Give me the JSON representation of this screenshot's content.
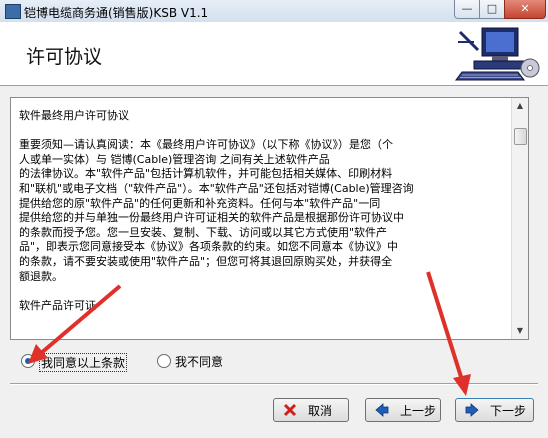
{
  "window": {
    "title": "铠博电缆商务通(销售版)KSB V1.1",
    "controls": {
      "minimize": "—",
      "maximize": "□",
      "close": "✕"
    }
  },
  "header": {
    "title": "许可协议"
  },
  "license": {
    "text": "软件最终用户许可协议\n\n重要须知—请认真阅读：本《最终用户许可协议》（以下称《协议》）是您（个\n人或单一实体）与 铠博(Cable)管理咨询 之间有关上述软件产品\n的法律协议。本\"软件产品\"包括计算机软件，并可能包括相关媒体、印刷材料\n和\"联机\"或电子文档（\"软件产品\"）。本\"软件产品\"还包括对铠博(Cable)管理咨询\n提供给您的原\"软件产品\"的任何更新和补充资料。任何与本\"软件产品\"一同\n提供给您的并与单独一份最终用户许可证相关的软件产品是根据那份许可协议中\n的条款而授予您。您一旦安装、复制、下载、访问或以其它方式使用\"软件产\n品\"，即表示您同意接受本《协议》各项条款的约束。如您不同意本《协议》中\n的条款，请不要安装或使用\"软件产品\"；但您可将其退回原购买处，并获得全\n额退款。\n\n软件产品许可证"
  },
  "options": {
    "agree_label": "我同意以上条款",
    "disagree_label": "我不同意",
    "selected": "agree"
  },
  "buttons": {
    "cancel_label": "取消",
    "back_label": "上一步",
    "next_label": "下一步"
  },
  "colors": {
    "annotation_arrow": "#e0302a"
  }
}
